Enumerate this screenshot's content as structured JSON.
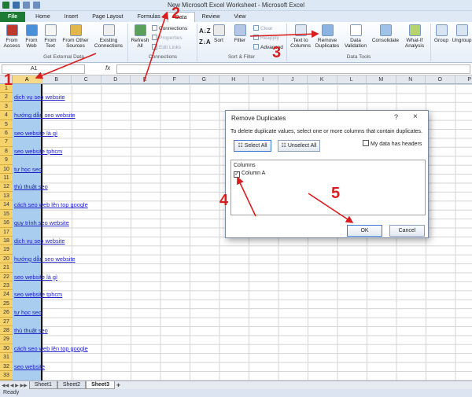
{
  "window": {
    "title": "New Microsoft Excel Worksheet - Microsoft Excel"
  },
  "tabs": [
    "File",
    "Home",
    "Insert",
    "Page Layout",
    "Formulas",
    "Data",
    "Review",
    "View"
  ],
  "ribbon": {
    "from_access": "From Access",
    "from_web": "From Web",
    "from_text": "From Text",
    "from_other": "From Other Sources",
    "existing": "Existing Connections",
    "refresh": "Refresh All",
    "connections": "Connections",
    "properties": "Properties",
    "edit_links": "Edit Links",
    "sort": "Sort",
    "filter": "Filter",
    "clear": "Clear",
    "reapply": "Reapply",
    "advanced": "Advanced",
    "text_to_cols": "Text to Columns",
    "remove_dup": "Remove Duplicates",
    "data_val": "Data Validation",
    "consolidate": "Consolidate",
    "what_if": "What-If Analysis",
    "group": "Group",
    "ungroup": "Ungroup",
    "grp_external": "Get External Data",
    "grp_connections": "Connections",
    "grp_sort": "Sort & Filter",
    "grp_tools": "Data Tools"
  },
  "formula_bar": {
    "name_box": "A1",
    "fx": "fx",
    "value": ""
  },
  "columns": [
    "A",
    "B",
    "C",
    "D",
    "E",
    "F",
    "G",
    "H",
    "I",
    "J",
    "K",
    "L",
    "M",
    "N",
    "O",
    "P"
  ],
  "rows": [
    "1",
    "2",
    "3",
    "4",
    "5",
    "6",
    "7",
    "8",
    "9",
    "10",
    "11",
    "12",
    "13",
    "14",
    "15",
    "16",
    "17",
    "18",
    "19",
    "20",
    "21",
    "22",
    "23",
    "24",
    "25",
    "26",
    "27",
    "28",
    "29",
    "30",
    "31",
    "32",
    "33"
  ],
  "cells": [
    "",
    "dịch vụ seo website",
    "",
    "hướng dẫn seo website",
    "",
    "seo website là gì",
    "",
    "seo website tphcm",
    "",
    "tự học seo",
    "",
    "thủ thuật seo",
    "",
    "cách seo web lên top google",
    "",
    "quy trình seo website",
    "",
    "dịch vụ seo website",
    "",
    "hướng dẫn seo website",
    "",
    "seo website là gì",
    "",
    "seo website tphcm",
    "",
    "tự học seo",
    "",
    "thủ thuật seo",
    "",
    "cách seo web lên top google",
    "",
    "seo website",
    ""
  ],
  "sheets": [
    "Sheet1",
    "Sheet2",
    "Sheet3"
  ],
  "status": "Ready",
  "dialog": {
    "title": "Remove Duplicates",
    "help": "?",
    "close": "×",
    "description": "To delete duplicate values, select one or more columns that contain duplicates.",
    "select_all": "Select All",
    "unselect_all": "Unselect All",
    "has_headers": "My data has headers",
    "columns_label": "Columns",
    "column_a": "Column A",
    "ok": "OK",
    "cancel": "Cancel"
  },
  "annotations": {
    "n1": "1",
    "n2": "2",
    "n3": "3",
    "n4": "4",
    "n5": "5"
  },
  "colors": {
    "file_tab": "#1e7b34",
    "selection": "#a9cdee",
    "row_header": "#f6d26a",
    "annotation": "#d81e1e"
  }
}
